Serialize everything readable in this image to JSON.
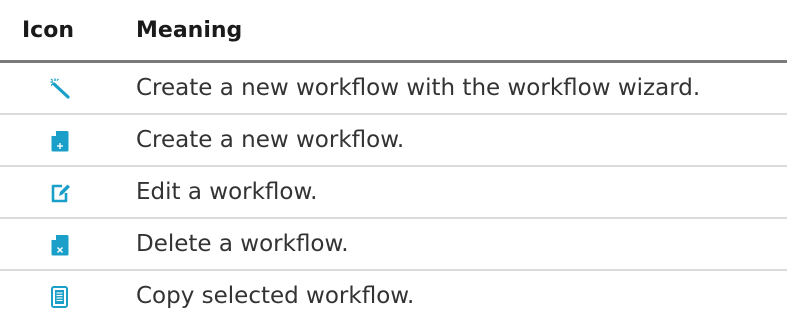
{
  "table": {
    "headers": {
      "icon": "Icon",
      "meaning": "Meaning"
    },
    "rows": [
      {
        "icon": "magic-wand-icon",
        "meaning": "Create a new workflow with the workflow wizard."
      },
      {
        "icon": "new-document-plus-icon",
        "meaning": "Create a new workflow."
      },
      {
        "icon": "edit-pencil-icon",
        "meaning": "Edit a workflow."
      },
      {
        "icon": "delete-document-icon",
        "meaning": "Delete a workflow."
      },
      {
        "icon": "copy-document-icon",
        "meaning": "Copy selected workflow."
      }
    ]
  },
  "colors": {
    "icon_accent": "#1aa0c8",
    "header_rule": "#7a7a7a",
    "row_rule": "#dcdcdc",
    "text": "#333333"
  }
}
